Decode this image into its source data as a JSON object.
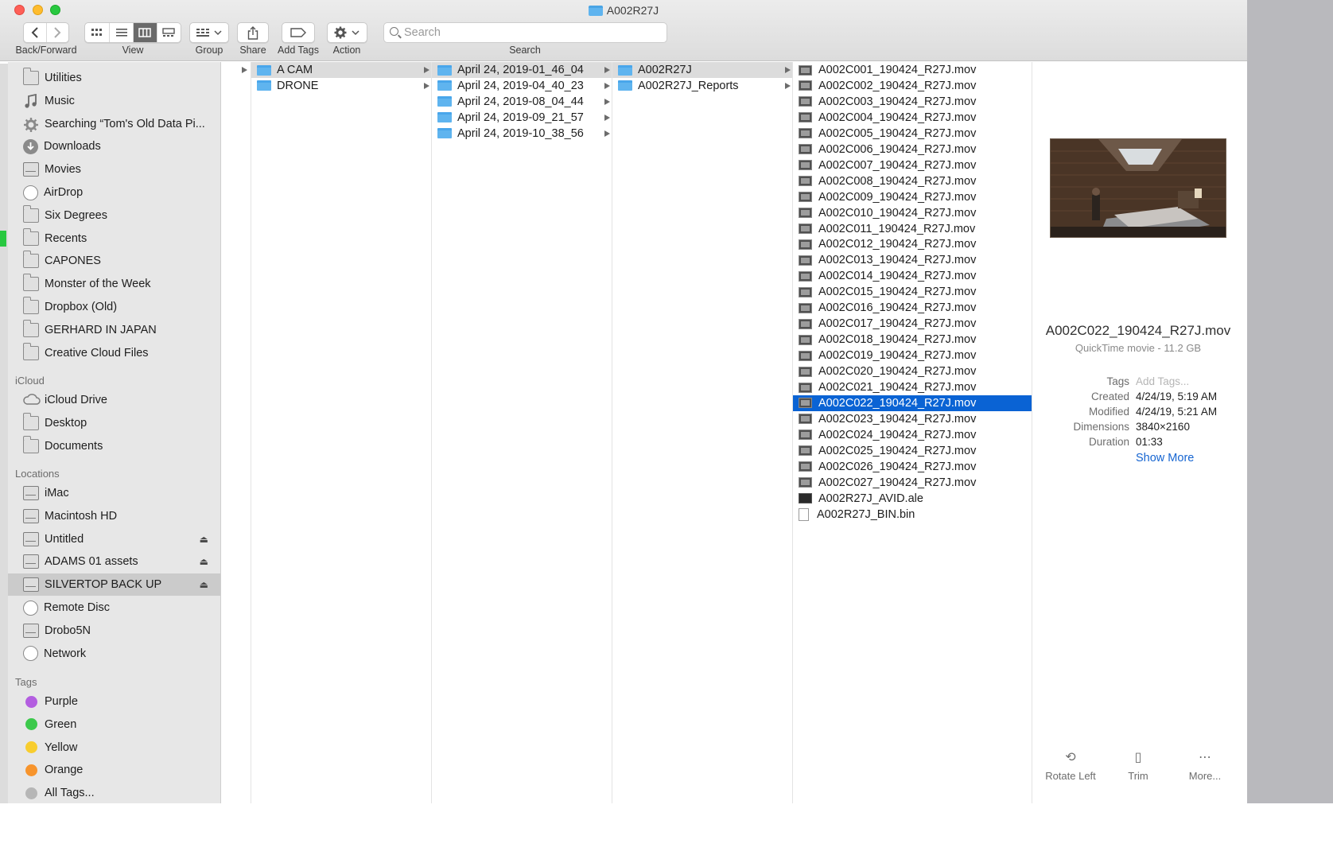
{
  "window": {
    "title": "A002R27J"
  },
  "toolbar": {
    "back_forward_label": "Back/Forward",
    "view_label": "View",
    "group_label": "Group",
    "share_label": "Share",
    "add_tags_label": "Add Tags",
    "action_label": "Action",
    "search_label": "Search",
    "search_placeholder": "Search"
  },
  "sidebar": {
    "favorites": [
      {
        "label": "Utilities",
        "icon": "folder-icon"
      },
      {
        "label": "Music",
        "icon": "music-icon"
      },
      {
        "label": "Searching “Tom's Old Data Pi...",
        "icon": "gear-icon"
      },
      {
        "label": "Downloads",
        "icon": "download-icon"
      },
      {
        "label": "Movies",
        "icon": "film-icon"
      },
      {
        "label": "AirDrop",
        "icon": "airdrop-icon"
      },
      {
        "label": "Six Degrees",
        "icon": "folder-icon"
      },
      {
        "label": "Recents",
        "icon": "recents-icon"
      },
      {
        "label": "CAPONES",
        "icon": "folder-icon"
      },
      {
        "label": "Monster of the Week",
        "icon": "folder-icon"
      },
      {
        "label": "Dropbox (Old)",
        "icon": "folder-icon"
      },
      {
        "label": "GERHARD IN JAPAN",
        "icon": "folder-icon"
      },
      {
        "label": "Creative Cloud Files",
        "icon": "folder-icon"
      }
    ],
    "icloud_header": "iCloud",
    "icloud": [
      {
        "label": "iCloud Drive",
        "icon": "cloud-icon"
      },
      {
        "label": "Desktop",
        "icon": "desktop-folder-icon"
      },
      {
        "label": "Documents",
        "icon": "documents-icon"
      }
    ],
    "locations_header": "Locations",
    "locations": [
      {
        "label": "iMac",
        "icon": "imac-icon"
      },
      {
        "label": "Macintosh HD",
        "icon": "hard-drive-icon"
      },
      {
        "label": "Untitled",
        "icon": "external-drive-icon",
        "eject": "⏏"
      },
      {
        "label": "ADAMS 01 assets",
        "icon": "external-drive-icon",
        "eject": "⏏"
      },
      {
        "label": "SILVERTOP BACK UP",
        "icon": "external-drive-icon",
        "eject": "⏏"
      },
      {
        "label": "Remote Disc",
        "icon": "disc-icon"
      },
      {
        "label": "Drobo5N",
        "icon": "server-icon"
      },
      {
        "label": "Network",
        "icon": "network-icon"
      }
    ],
    "selected_location": "SILVERTOP BACK UP",
    "tags_header": "Tags",
    "tags": [
      {
        "label": "Purple",
        "color": "#b35ee0"
      },
      {
        "label": "Green",
        "color": "#3cc94b"
      },
      {
        "label": "Yellow",
        "color": "#f8cd2e"
      },
      {
        "label": "Orange",
        "color": "#f7942c"
      },
      {
        "label": "All Tags...",
        "color": "#b6b6b6"
      }
    ]
  },
  "columns": [
    {
      "items": [
        {
          "label": "A CAM",
          "type": "folder",
          "path": true
        },
        {
          "label": "DRONE",
          "type": "folder"
        }
      ]
    },
    {
      "items": [
        {
          "label": "April 24, 2019-01_46_04",
          "type": "folder",
          "path": true
        },
        {
          "label": "April 24, 2019-04_40_23",
          "type": "folder"
        },
        {
          "label": "April 24, 2019-08_04_44",
          "type": "folder"
        },
        {
          "label": "April 24, 2019-09_21_57",
          "type": "folder"
        },
        {
          "label": "April 24, 2019-10_38_56",
          "type": "folder"
        }
      ]
    },
    {
      "items": [
        {
          "label": "A002R27J",
          "type": "folder",
          "path": true
        },
        {
          "label": "A002R27J_Reports",
          "type": "folder"
        }
      ]
    },
    {
      "items": [
        {
          "label": "A002C001_190424_R27J.mov",
          "type": "mov"
        },
        {
          "label": "A002C002_190424_R27J.mov",
          "type": "mov"
        },
        {
          "label": "A002C003_190424_R27J.mov",
          "type": "mov"
        },
        {
          "label": "A002C004_190424_R27J.mov",
          "type": "mov"
        },
        {
          "label": "A002C005_190424_R27J.mov",
          "type": "mov"
        },
        {
          "label": "A002C006_190424_R27J.mov",
          "type": "mov"
        },
        {
          "label": "A002C007_190424_R27J.mov",
          "type": "mov"
        },
        {
          "label": "A002C008_190424_R27J.mov",
          "type": "mov"
        },
        {
          "label": "A002C009_190424_R27J.mov",
          "type": "mov"
        },
        {
          "label": "A002C010_190424_R27J.mov",
          "type": "mov"
        },
        {
          "label": "A002C011_190424_R27J.mov",
          "type": "mov"
        },
        {
          "label": "A002C012_190424_R27J.mov",
          "type": "mov"
        },
        {
          "label": "A002C013_190424_R27J.mov",
          "type": "mov"
        },
        {
          "label": "A002C014_190424_R27J.mov",
          "type": "mov"
        },
        {
          "label": "A002C015_190424_R27J.mov",
          "type": "mov"
        },
        {
          "label": "A002C016_190424_R27J.mov",
          "type": "mov"
        },
        {
          "label": "A002C017_190424_R27J.mov",
          "type": "mov"
        },
        {
          "label": "A002C018_190424_R27J.mov",
          "type": "mov"
        },
        {
          "label": "A002C019_190424_R27J.mov",
          "type": "mov"
        },
        {
          "label": "A002C020_190424_R27J.mov",
          "type": "mov"
        },
        {
          "label": "A002C021_190424_R27J.mov",
          "type": "mov"
        },
        {
          "label": "A002C022_190424_R27J.mov",
          "type": "mov",
          "selected": true
        },
        {
          "label": "A002C023_190424_R27J.mov",
          "type": "mov"
        },
        {
          "label": "A002C024_190424_R27J.mov",
          "type": "mov"
        },
        {
          "label": "A002C025_190424_R27J.mov",
          "type": "mov"
        },
        {
          "label": "A002C026_190424_R27J.mov",
          "type": "mov"
        },
        {
          "label": "A002C027_190424_R27J.mov",
          "type": "mov"
        },
        {
          "label": "A002R27J_AVID.ale",
          "type": "ale"
        },
        {
          "label": "A002R27J_BIN.bin",
          "type": "bin"
        }
      ]
    }
  ],
  "preview": {
    "filename": "A002C022_190424_R27J.mov",
    "kind": "QuickTime movie - 11.2 GB",
    "meta": [
      {
        "key": "Tags",
        "value": "Add Tags...",
        "placeholder": true
      },
      {
        "key": "Created",
        "value": "4/24/19, 5:19 AM"
      },
      {
        "key": "Modified",
        "value": "4/24/19, 5:21 AM"
      },
      {
        "key": "Dimensions",
        "value": "3840×2160"
      },
      {
        "key": "Duration",
        "value": "01:33"
      }
    ],
    "show_more": "Show More",
    "actions": [
      {
        "label": "Rotate Left",
        "icon": "rotate-left-icon"
      },
      {
        "label": "Trim",
        "icon": "trim-icon"
      },
      {
        "label": "More...",
        "icon": "more-icon"
      }
    ]
  },
  "colors": {
    "selection": "#0a63d4",
    "folder": "#5fb4ef",
    "link": "#1665d1"
  }
}
